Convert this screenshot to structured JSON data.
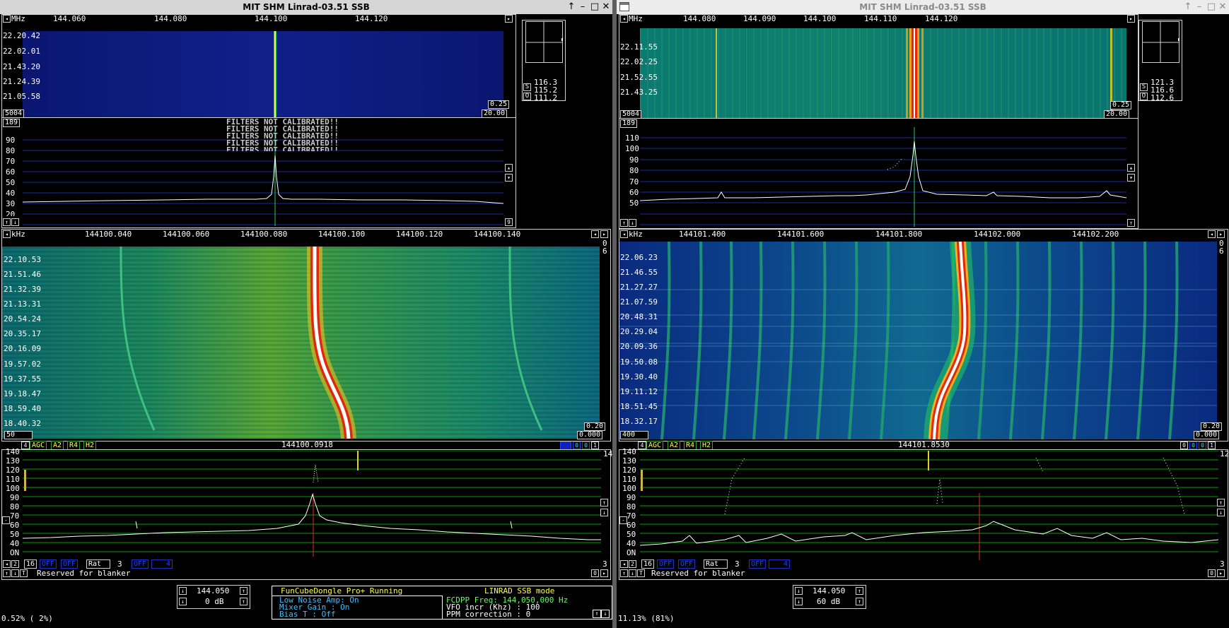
{
  "left": {
    "title": "MIT SHM Linrad-03.51 SSB",
    "wide_axis_unit": "MHz",
    "wide_axis_ticks": [
      "144.060",
      "144.080",
      "144.100",
      "144.120"
    ],
    "wide_times": [
      "22.20.42",
      "22.02.01",
      "21.43.20",
      "21.24.39",
      "21.05.58"
    ],
    "wide_left_val": "5004",
    "wide_right_val_top": "0.25",
    "wide_right_val_bottom": "20.00",
    "smeter": [
      "116.3",
      "115.2",
      "111.2"
    ],
    "smeter_letters": [
      "S",
      "O"
    ],
    "spec_top_val": "189",
    "spec_scale": [
      "90",
      "80",
      "70",
      "60",
      "50",
      "40",
      "30",
      "20"
    ],
    "filters_msg": [
      "FILTERS NOT CALIBRATED!!",
      "FILTERS NOT CALIBRATED!!",
      "FILTERS NOT CALIBRATED!!",
      "FILTERS NOT CALIBRATED!!",
      "FILTERS NOT CALIBRATED!!"
    ],
    "spec_bottom_right": "9",
    "narrow_axis_unit": "kHz",
    "narrow_axis_ticks": [
      "144100.040",
      "144100.060",
      "144100.080",
      "144100.100",
      "144100.120",
      "144100.140"
    ],
    "narrow_times": [
      "22.10.53",
      "21.51.46",
      "21.32.39",
      "21.13.31",
      "20.54.24",
      "20.35.17",
      "20.16.09",
      "19.57.02",
      "19.37.55",
      "19.18.47",
      "18.59.40",
      "18.40.32"
    ],
    "narrow_right_top": [
      "0",
      "6"
    ],
    "narrow_left_val": "50",
    "narrow_right_val_top": "0.20",
    "narrow_right_val_bottom": "0.000",
    "ctrl_num": "4",
    "ctrl_buttons": [
      "AGC",
      "A2",
      "R4",
      "H2"
    ],
    "center_freq": "144100.0918",
    "ctrl_right": [
      "0",
      "0",
      "1"
    ],
    "base_right_top": "14",
    "base_scale": [
      "140",
      "130",
      "120",
      "110",
      "100",
      "90",
      "80",
      "70",
      "60",
      "50",
      "40",
      "ON"
    ],
    "base_row1": [
      "2",
      "16",
      "OFF",
      "OFF",
      "Rat",
      "3",
      "OFF",
      "4"
    ],
    "base_row1_right": "3",
    "base_row2_text": "Reserved for blanker",
    "base_row2_right": "0",
    "freq_box": "144.050",
    "gain_box": "0 dB",
    "cpu": "0.52%  ( 2%)",
    "fcd_title": "FunCubeDongle Pro+  Running",
    "fcd_mode": "LINRAD  SSB mode",
    "fcd_lna": "Low Noise Amp:  On",
    "fcd_mixer": "Mixer Gain   :  On",
    "fcd_bias": "Bias T       : Off",
    "fcd_freq": "FCDPP Freq:    144,050,000 Hz",
    "fcd_vfo": "VFO incr (Khz) : 100",
    "fcd_ppm": "PPM correction : 0"
  },
  "right": {
    "title": "MIT SHM Linrad-03.51 SSB",
    "wide_axis_unit": "MHz",
    "wide_axis_ticks": [
      "144.080",
      "144.090",
      "144.100",
      "144.110",
      "144.120"
    ],
    "wide_times": [
      "22.11.55",
      "22.02.25",
      "21.52.55",
      "21.43.25"
    ],
    "wide_left_val": "5004",
    "wide_right_val_top": "0.25",
    "wide_right_val_bottom": "20.00",
    "smeter": [
      "121.3",
      "116.6",
      "112.6"
    ],
    "smeter_letters": [
      "S",
      "O"
    ],
    "spec_top_val": "189",
    "spec_scale": [
      "110",
      "100",
      "90",
      "80",
      "70",
      "60",
      "50"
    ],
    "narrow_axis_unit": "kHz",
    "narrow_axis_ticks": [
      "144101.400",
      "144101.600",
      "144101.800",
      "144102.000",
      "144102.200"
    ],
    "narrow_times": [
      "22.06.23",
      "21.46.55",
      "21.27.27",
      "21.07.59",
      "20.48.31",
      "20.29.04",
      "20.09.36",
      "19.50.08",
      "19.30.40",
      "19.11.12",
      "18.51.45",
      "18.32.17"
    ],
    "narrow_right_top": [
      "0",
      "6"
    ],
    "narrow_left_val": "400",
    "narrow_right_val_top": "0.20",
    "narrow_right_val_bottom": "0.000",
    "ctrl_num": "4",
    "ctrl_buttons": [
      "AGC",
      "A2",
      "R4",
      "H2"
    ],
    "center_freq": "144101.8530",
    "ctrl_right": [
      "0",
      "0",
      "0",
      "1"
    ],
    "base_right_top": "12",
    "base_scale": [
      "140",
      "130",
      "120",
      "110",
      "100",
      "90",
      "80",
      "70",
      "60",
      "50",
      "40",
      "ON"
    ],
    "base_row1": [
      "2",
      "16",
      "OFF",
      "OFF",
      "Rat",
      "3",
      "OFF",
      "4"
    ],
    "base_row1_right": "3",
    "base_row2_text": "Reserved for blanker",
    "base_row2_right": "0",
    "freq_box": "144.050",
    "gain_box": "60 dB",
    "cpu": "11.13% (81%)"
  },
  "colors": {
    "grid_blue": "#1a2aa0",
    "grid_green": "#00a000",
    "wf_left_blue": "#0a1a7a",
    "wf_right_teal": "#0a6e70",
    "signal": "#ff3010"
  },
  "icons": [
    "arrow-left-icon",
    "arrow-right-icon",
    "arrow-up-icon",
    "arrow-down-icon",
    "minimize-icon",
    "maximize-icon",
    "close-icon",
    "window-menu-icon"
  ]
}
